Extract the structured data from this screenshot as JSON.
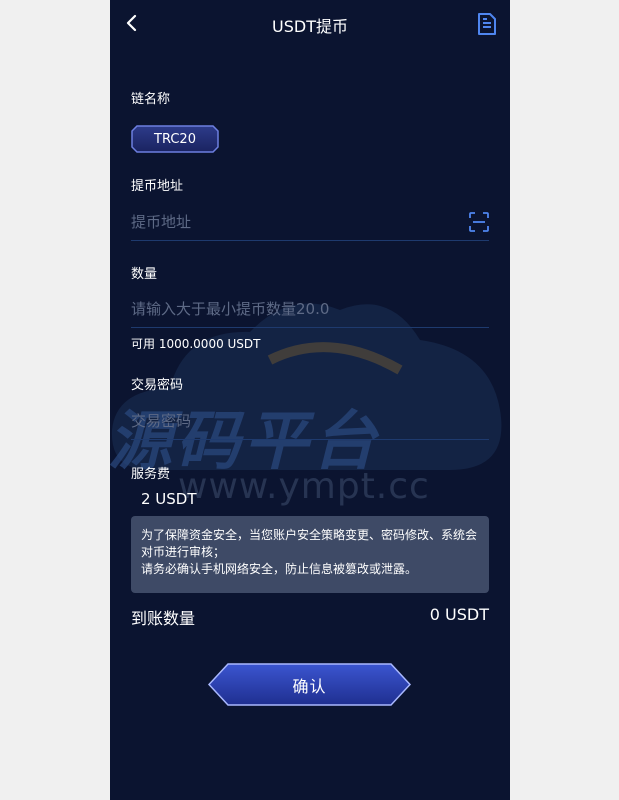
{
  "header": {
    "title": "USDT提币",
    "back_icon": "chevron-left-icon",
    "record_icon": "document-icon"
  },
  "chain": {
    "label": "链名称",
    "selected": "TRC20"
  },
  "address": {
    "label": "提币地址",
    "placeholder": "提币地址",
    "value": "",
    "scan_icon": "scan-icon"
  },
  "amount": {
    "label": "数量",
    "placeholder": "请输入大于最小提币数量20.0",
    "value": "",
    "available": "可用 1000.0000 USDT"
  },
  "password": {
    "label": "交易密码",
    "placeholder": "交易密码",
    "value": ""
  },
  "fee": {
    "label": "服务费",
    "value": "2 USDT"
  },
  "notice": {
    "line1": "为了保障资金安全，当您账户安全策略变更、密码修改、系统会对币进行审核；",
    "line2": "请务必确认手机网络安全，防止信息被篡改或泄露。"
  },
  "receive": {
    "label": "到账数量",
    "value": "0 USDT"
  },
  "confirm": {
    "label": "确认"
  },
  "watermark": {
    "text": "源码平台",
    "url": "www.ympt.cc"
  },
  "colors": {
    "background": "#0b1430",
    "accent": "#3a6fe0",
    "button_fill": "#2a3fa8",
    "notice_bg": "#3e4a66",
    "input_line": "#1e3a6e"
  }
}
